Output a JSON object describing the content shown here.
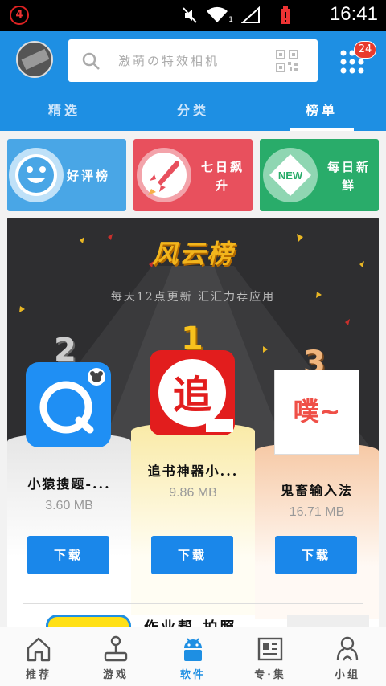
{
  "status_bar": {
    "notification_count": "4",
    "time": "16:41",
    "signal_label": "1"
  },
  "header": {
    "search_placeholder": "激萌の特效相机",
    "menu_badge": "24",
    "tabs": [
      {
        "label": "精选",
        "active": false
      },
      {
        "label": "分类",
        "active": false
      },
      {
        "label": "榜单",
        "active": true
      }
    ]
  },
  "categories": [
    {
      "label": "好评榜",
      "icon": "smiley-icon",
      "color": "#49a6e6"
    },
    {
      "label": "七日飙升",
      "icon": "rocket-icon",
      "color": "#e8505d"
    },
    {
      "label": "每日新鲜",
      "icon": "new-badge-icon",
      "badge_text": "NEW",
      "color": "#29ac6a"
    }
  ],
  "ranking": {
    "title": "风云榜",
    "subtitle": "每天12点更新 汇汇力荐应用",
    "apps": [
      {
        "rank": "2",
        "name": "小猿搜题-...",
        "size": "3.60 MB",
        "button": "下载",
        "icon": "search-q-icon"
      },
      {
        "rank": "1",
        "name": "追书神器小...",
        "size": "9.86 MB",
        "button": "下载",
        "icon": "zhui-icon",
        "icon_text": "追"
      },
      {
        "rank": "3",
        "name": "鬼畜输入法",
        "size": "16.71 MB",
        "button": "下载",
        "icon": "pu-icon",
        "icon_text": "噗~"
      }
    ],
    "next_title": "作业帮-拍照"
  },
  "bottom_nav": [
    {
      "label": "推荐",
      "icon": "home-icon",
      "active": false
    },
    {
      "label": "游戏",
      "icon": "joystick-icon",
      "active": false
    },
    {
      "label": "软件",
      "icon": "android-icon",
      "active": true
    },
    {
      "label": "专·集",
      "icon": "newspaper-icon",
      "active": false
    },
    {
      "label": "小组",
      "icon": "group-icon",
      "active": false
    }
  ]
}
